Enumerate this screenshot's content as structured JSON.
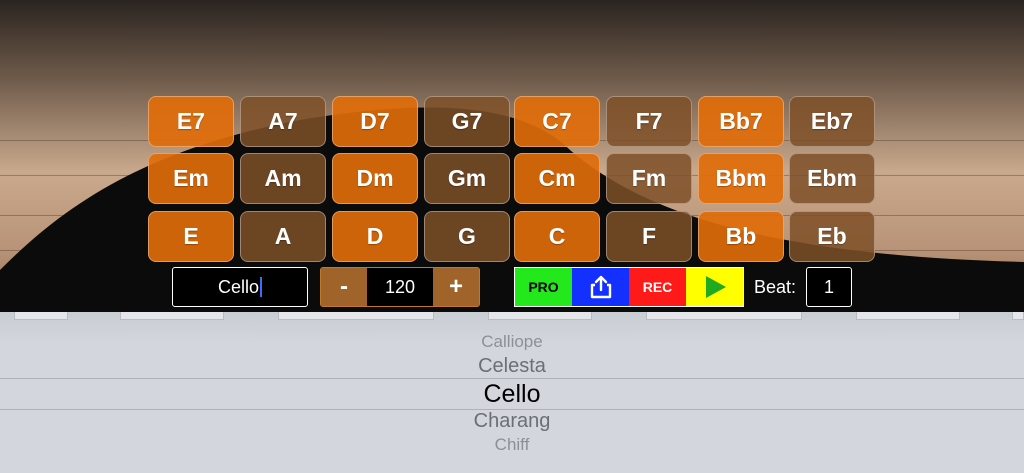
{
  "chords": {
    "row1": [
      "E7",
      "A7",
      "D7",
      "G7",
      "C7",
      "F7",
      "Bb7",
      "Eb7"
    ],
    "row2": [
      "Em",
      "Am",
      "Dm",
      "Gm",
      "Cm",
      "Fm",
      "Bbm",
      "Ebm"
    ],
    "row3": [
      "E",
      "A",
      "D",
      "G",
      "C",
      "F",
      "Bb",
      "Eb"
    ]
  },
  "instrument": {
    "value": "Cello"
  },
  "tempo": {
    "minus_label": "-",
    "value": "120",
    "plus_label": "+"
  },
  "toolbar": {
    "pro_label": "PRO",
    "share_icon": "share-icon",
    "rec_label": "REC",
    "play_icon": "play-icon"
  },
  "beat": {
    "label": "Beat:",
    "value": "1"
  },
  "picker": {
    "items": [
      "Calliope",
      "Celesta",
      "Cello",
      "Charang",
      "Chiff"
    ],
    "selected": "Cello"
  },
  "colors": {
    "orange_button": "#e06c0a",
    "brown_button": "#7e5028",
    "pro": "#22e81c",
    "share": "#1330ff",
    "rec": "#ff1a1a",
    "play": "#ffff00"
  }
}
